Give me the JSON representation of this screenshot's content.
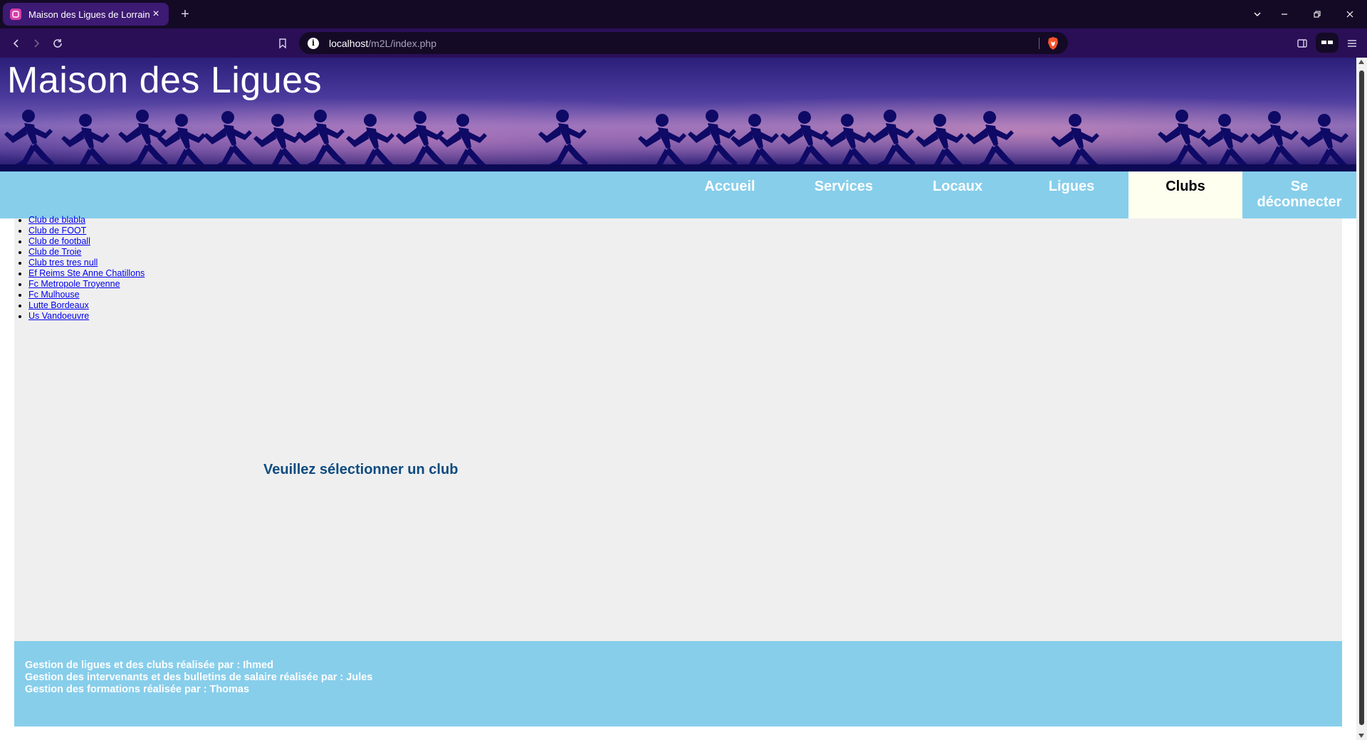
{
  "browser": {
    "tab_title": "Maison des Ligues de Lorraine",
    "url_host": "localhost",
    "url_path": "/m2L/index.php"
  },
  "site": {
    "title": "Maison des Ligues"
  },
  "nav": {
    "items": [
      {
        "label": "Accueil"
      },
      {
        "label": "Services"
      },
      {
        "label": "Locaux"
      },
      {
        "label": "Ligues"
      },
      {
        "label": "Clubs"
      },
      {
        "label": "Se déconnecter"
      }
    ],
    "active": "Clubs"
  },
  "clubs": [
    "Club de blabla",
    "Club de FOOT",
    "Club de football",
    "Club de Troie",
    "Club tres tres null",
    "Ef Reims Ste Anne Chatillons",
    "Fc Metropole Troyenne",
    "Fc Mulhouse",
    "Lutte Bordeaux",
    "Us Vandoeuvre"
  ],
  "main": {
    "message": "Veuillez sélectionner un club"
  },
  "footer": {
    "lines": [
      "Gestion de ligues et des clubs réalisée par : Ihmed",
      "Gestion des intervenants et des bulletins de salaire réalisée par : Jules",
      "Gestion des formations réalisée par : Thomas"
    ]
  },
  "colors": {
    "nav_bg": "#87ceeb",
    "active_nav_bg": "#fffff0",
    "content_bg": "#efefef",
    "message_color": "#0d4b80",
    "link_color": "#0000ee"
  }
}
